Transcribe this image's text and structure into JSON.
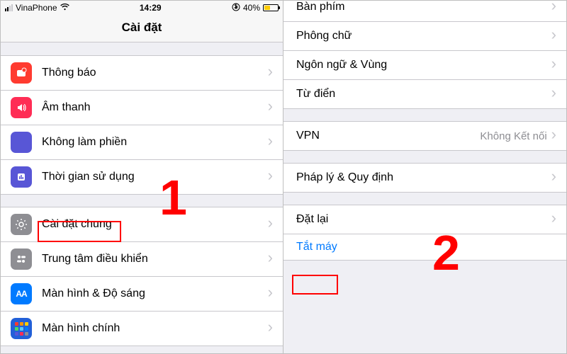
{
  "statusbar": {
    "carrier": "VinaPhone",
    "time": "14:29",
    "battery_pct": "40%",
    "battery_fill_pct": 40
  },
  "left": {
    "title": "Cài đặt",
    "group1": [
      {
        "label": "Thông báo"
      },
      {
        "label": "Âm thanh"
      },
      {
        "label": "Không làm phiền"
      },
      {
        "label": "Thời gian sử dụng"
      }
    ],
    "group2": [
      {
        "label": "Cài đặt chung"
      },
      {
        "label": "Trung tâm điều khiển"
      },
      {
        "label": "Màn hình & Độ sáng"
      },
      {
        "label": "Màn hình chính"
      }
    ]
  },
  "right": {
    "group1": [
      {
        "label": "Bàn phím"
      },
      {
        "label": "Phông chữ"
      },
      {
        "label": "Ngôn ngữ & Vùng"
      },
      {
        "label": "Từ điển"
      }
    ],
    "group2": [
      {
        "label": "VPN",
        "detail": "Không Kết nối"
      }
    ],
    "group3": [
      {
        "label": "Pháp lý & Quy định"
      }
    ],
    "group4": [
      {
        "label": "Đặt lại"
      },
      {
        "label": "Tắt máy",
        "link": true
      }
    ]
  },
  "annotations": {
    "step1": "1",
    "step2": "2"
  }
}
